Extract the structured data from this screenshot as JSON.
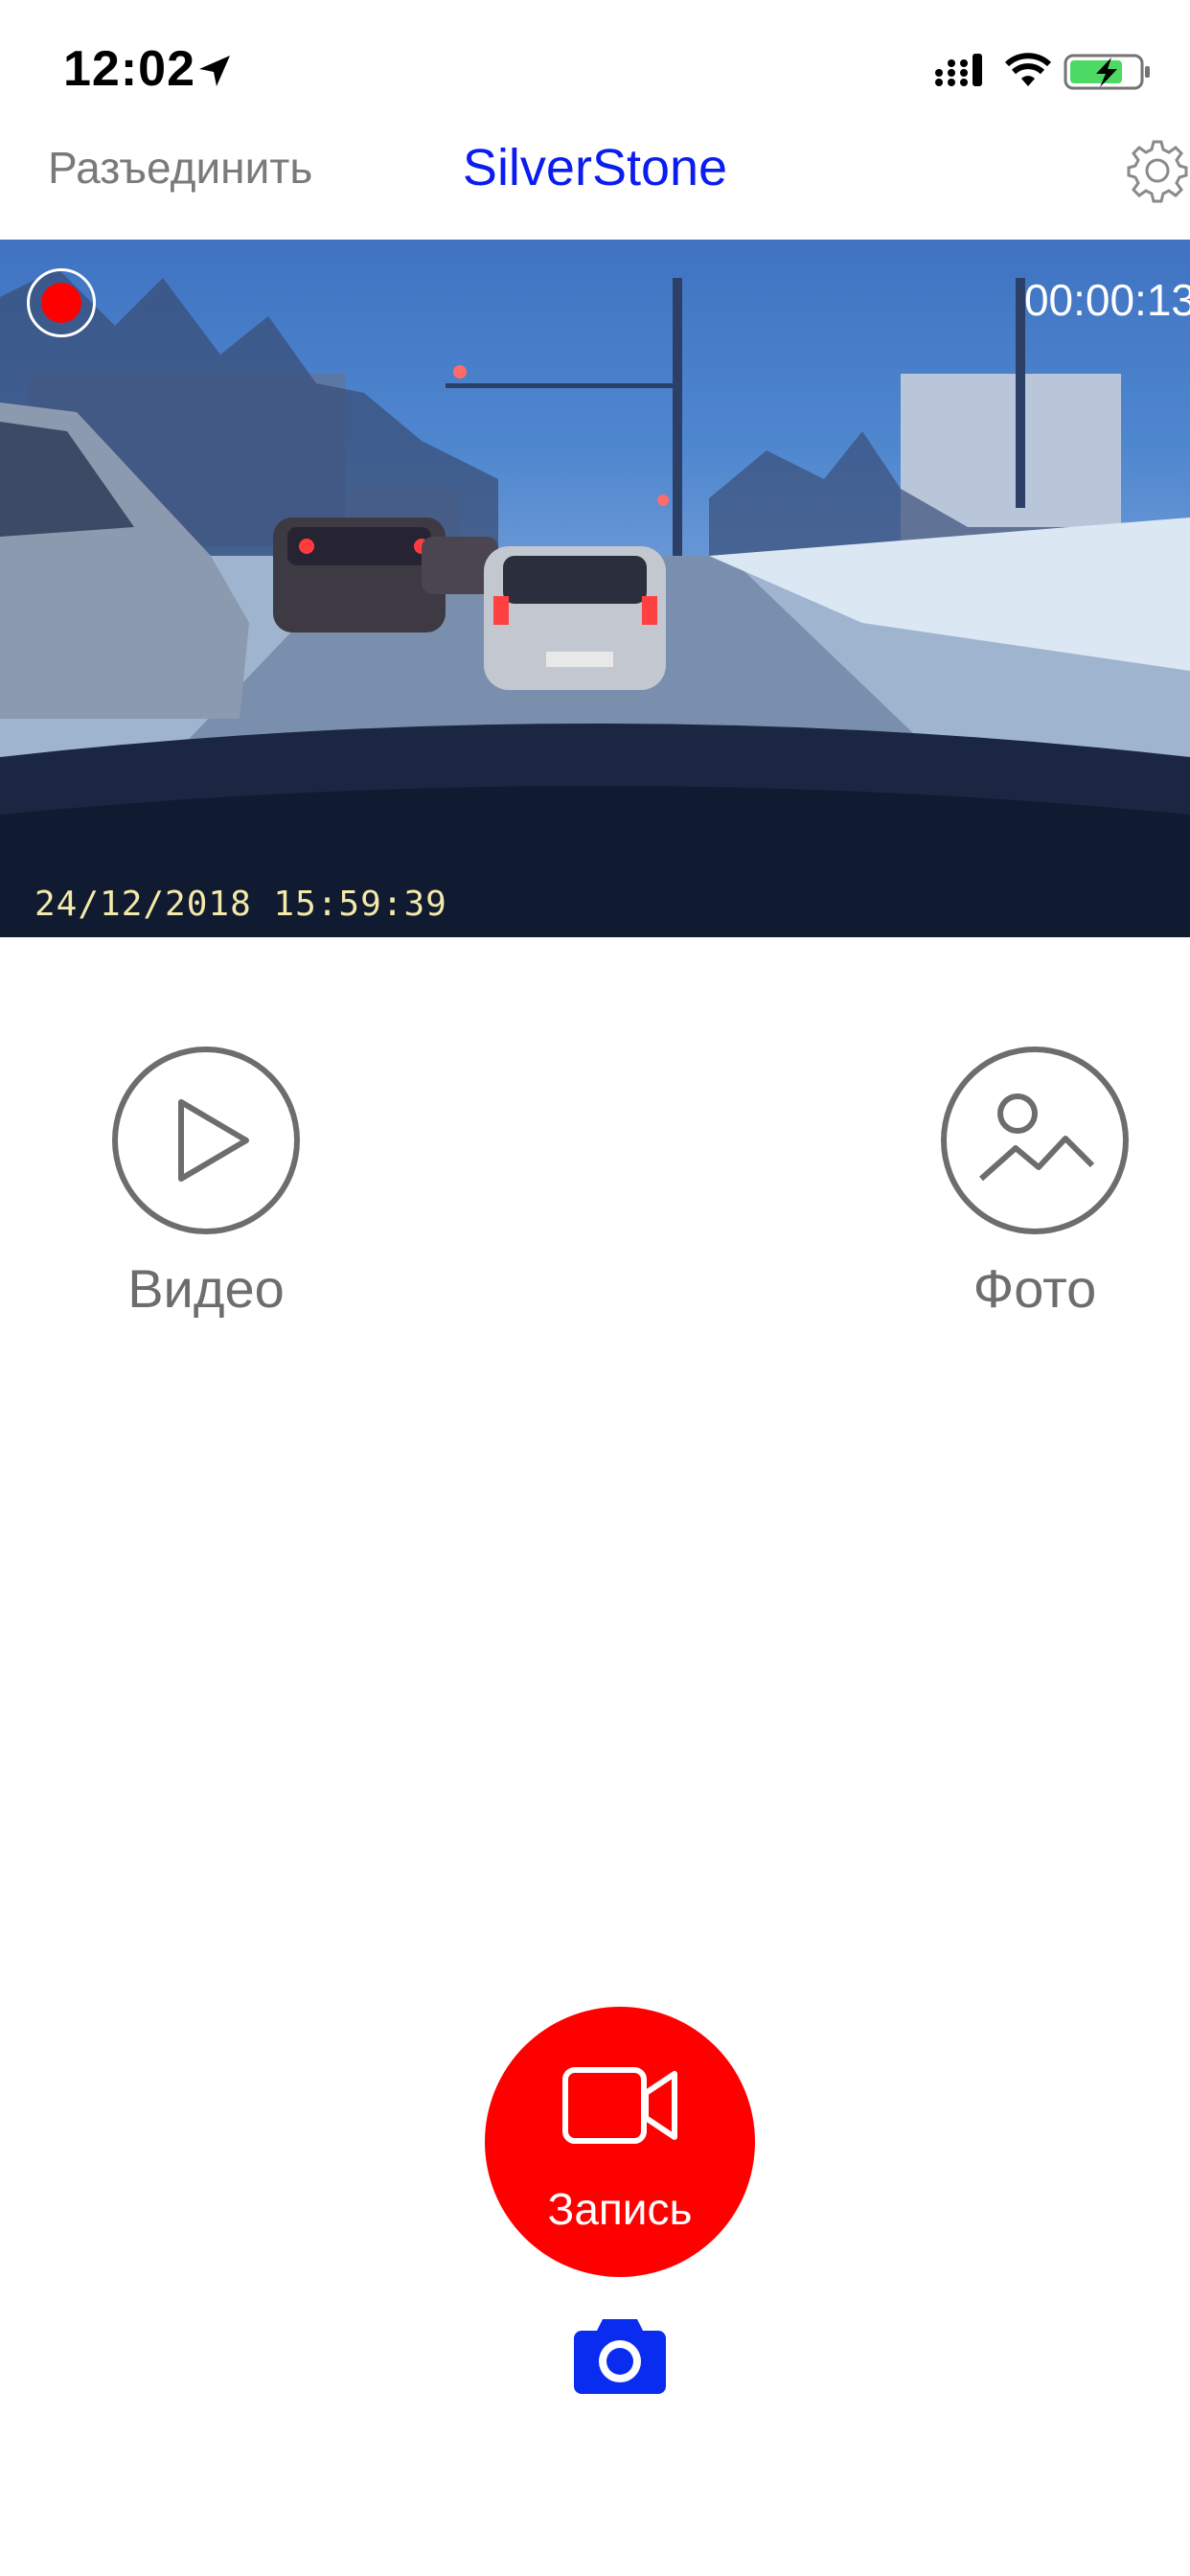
{
  "status_bar": {
    "time": "12:02",
    "icons": [
      "location-arrow-icon",
      "signal-icon",
      "wifi-icon",
      "battery-charging-icon"
    ],
    "battery_color": "#4cd964"
  },
  "nav": {
    "disconnect_label": "Разъединить",
    "title": "SilverStone",
    "title_color": "#0a1cf0",
    "settings_icon": "gear-icon"
  },
  "feed": {
    "elapsed": "00:00:13",
    "osd_timestamp": "24/12/2018  15:59:39",
    "recording_color": "#ff0000"
  },
  "modes": [
    {
      "label": "Видео",
      "icon": "play-circle-icon"
    },
    {
      "label": "Фото",
      "icon": "image-circle-icon"
    }
  ],
  "controls": {
    "record_label": "Запись",
    "record_color": "#ff0000",
    "record_icon": "video-camera-icon",
    "snapshot_icon": "camera-icon",
    "snapshot_color": "#0a2cf0"
  }
}
